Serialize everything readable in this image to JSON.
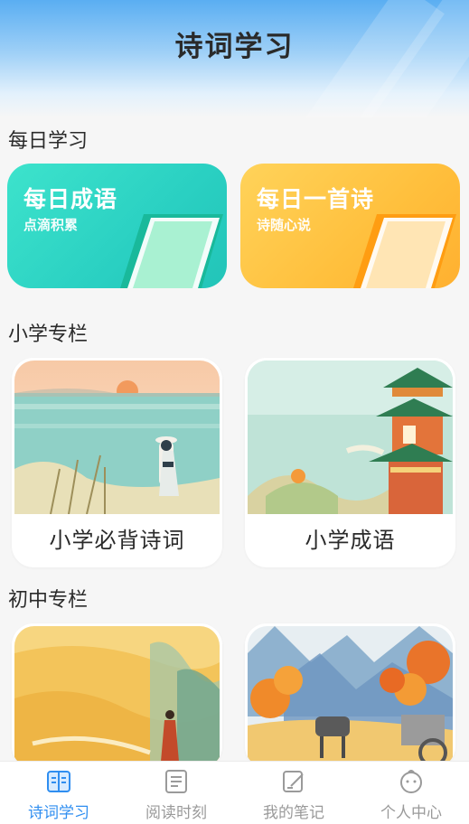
{
  "header": {
    "title": "诗词学习"
  },
  "sections": {
    "daily": {
      "title": "每日学习",
      "cards": [
        {
          "title": "每日成语",
          "subtitle": "点滴积累"
        },
        {
          "title": "每日一首诗",
          "subtitle": "诗随心说"
        }
      ]
    },
    "primary": {
      "title": "小学专栏",
      "cards": [
        {
          "label": "小学必背诗词"
        },
        {
          "label": "小学成语"
        }
      ]
    },
    "junior": {
      "title": "初中专栏"
    }
  },
  "tabbar": {
    "items": [
      {
        "label": "诗词学习",
        "icon": "book-icon",
        "active": true
      },
      {
        "label": "阅读时刻",
        "icon": "document-icon",
        "active": false
      },
      {
        "label": "我的笔记",
        "icon": "edit-note-icon",
        "active": false
      },
      {
        "label": "个人中心",
        "icon": "face-icon",
        "active": false
      }
    ]
  },
  "colors": {
    "accent": "#2f8ef0",
    "daily_green": "#2ad0c2",
    "daily_orange": "#ffbf3c",
    "inactive": "#9a9a9a"
  }
}
